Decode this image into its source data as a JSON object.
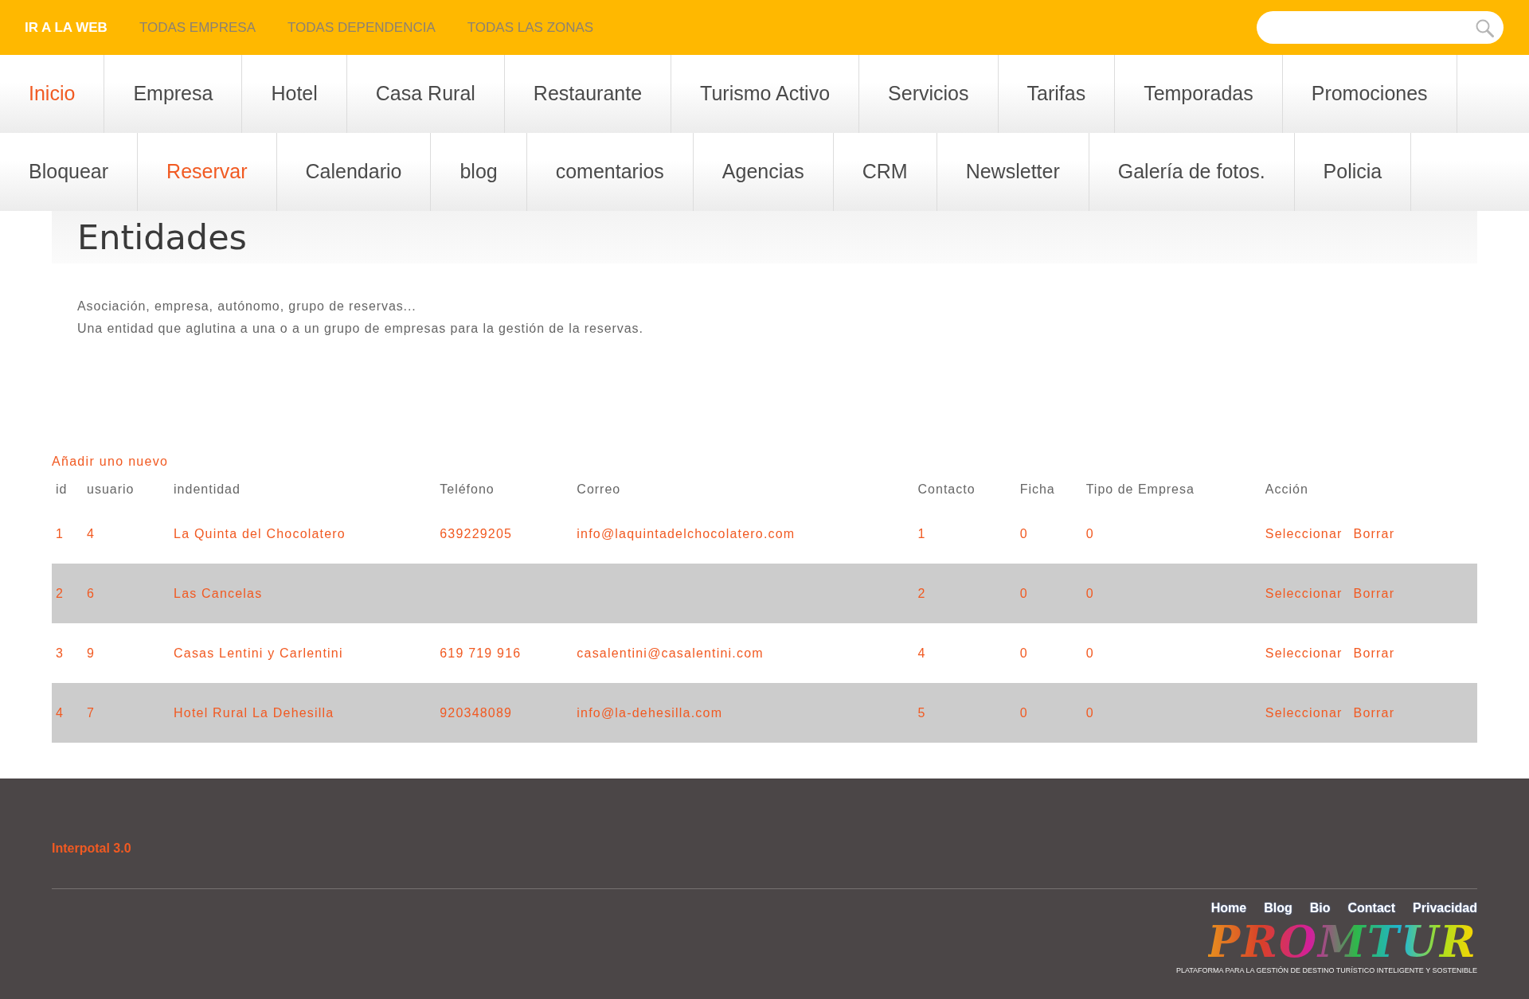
{
  "top_bar": {
    "links": [
      {
        "label": "IR A LA WEB",
        "selected": true
      },
      {
        "label": "TODAS EMPRESA",
        "selected": false
      },
      {
        "label": "TODAS DEPENDENCIA",
        "selected": false
      },
      {
        "label": "TODAS LAS ZONAS",
        "selected": false
      }
    ]
  },
  "main_menu": {
    "rows": [
      {
        "items": [
          {
            "label": "Inicio",
            "selected": true
          },
          {
            "label": "Empresa",
            "selected": false
          },
          {
            "label": "Hotel",
            "selected": false
          },
          {
            "label": "Casa Rural",
            "selected": false
          },
          {
            "label": "Restaurante",
            "selected": false
          },
          {
            "label": "Turismo Activo",
            "selected": false
          },
          {
            "label": "Servicios",
            "selected": false
          },
          {
            "label": "Tarifas",
            "selected": false
          },
          {
            "label": "Temporadas",
            "selected": false
          },
          {
            "label": "Promociones",
            "selected": false
          }
        ]
      },
      {
        "items": [
          {
            "label": "Bloquear",
            "selected": false
          },
          {
            "label": "Reservar",
            "selected": true
          },
          {
            "label": "Calendario",
            "selected": false
          },
          {
            "label": "blog",
            "selected": false
          },
          {
            "label": "comentarios",
            "selected": false
          },
          {
            "label": "Agencias",
            "selected": false
          },
          {
            "label": "CRM",
            "selected": false
          },
          {
            "label": "Newsletter",
            "selected": false
          },
          {
            "label": "Galería de fotos.",
            "selected": false
          },
          {
            "label": "Policia",
            "selected": false
          }
        ]
      }
    ]
  },
  "page": {
    "title": "Entidades",
    "description_lines": [
      "Asociación, empresa, autónomo, grupo de reservas...",
      "Una entidad que aglutina a una o a un grupo de empresas para la gestión de la reservas."
    ]
  },
  "table": {
    "add_link": "Añadir uno nuevo",
    "columns": [
      "id",
      "usuario",
      "indentidad",
      "Teléfono",
      "Correo",
      "Contacto",
      "Ficha",
      "Tipo de Empresa",
      "Acción"
    ],
    "rows": [
      {
        "cells": [
          "1",
          "4",
          "La Quinta del Chocolatero",
          "639229205",
          "info@laquintadelchocolatero.com",
          "1",
          "0",
          "0"
        ],
        "actions": [
          "Seleccionar",
          "Borrar"
        ]
      },
      {
        "cells": [
          "2",
          "6",
          "Las Cancelas",
          null,
          null,
          "2",
          "0",
          "0"
        ],
        "actions": [
          "Seleccionar",
          "Borrar"
        ]
      },
      {
        "cells": [
          "3",
          "9",
          "Casas Lentini y Carlentini",
          "619 719 916",
          "casalentini@casalentini.com",
          "4",
          "0",
          "0"
        ],
        "actions": [
          "Seleccionar",
          "Borrar"
        ]
      },
      {
        "cells": [
          "4",
          "7",
          "Hotel Rural La Dehesilla",
          "920348089",
          "info@la-dehesilla.com",
          "5",
          "0",
          "0"
        ],
        "actions": [
          "Seleccionar",
          "Borrar"
        ]
      }
    ]
  },
  "footer": {
    "title": "Interpotal 3.0",
    "links": [
      "Home",
      "Blog",
      "Bio",
      "Contact",
      "Privacidad"
    ],
    "logo": {
      "name": "PROMTUR",
      "tagline": "PLATAFORMA PARA LA GESTIÓN DE DESTINO TURÍSTICO INTELIGENTE Y SOSTENIBLE"
    }
  }
}
